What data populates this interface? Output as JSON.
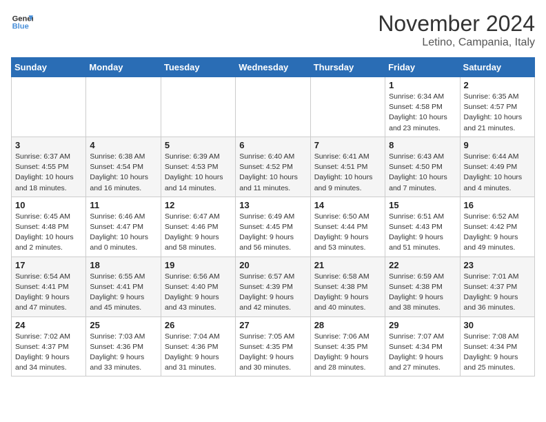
{
  "header": {
    "logo_line1": "General",
    "logo_line2": "Blue",
    "month": "November 2024",
    "location": "Letino, Campania, Italy"
  },
  "days_of_week": [
    "Sunday",
    "Monday",
    "Tuesday",
    "Wednesday",
    "Thursday",
    "Friday",
    "Saturday"
  ],
  "weeks": [
    [
      {
        "day": "",
        "info": ""
      },
      {
        "day": "",
        "info": ""
      },
      {
        "day": "",
        "info": ""
      },
      {
        "day": "",
        "info": ""
      },
      {
        "day": "",
        "info": ""
      },
      {
        "day": "1",
        "info": "Sunrise: 6:34 AM\nSunset: 4:58 PM\nDaylight: 10 hours and 23 minutes."
      },
      {
        "day": "2",
        "info": "Sunrise: 6:35 AM\nSunset: 4:57 PM\nDaylight: 10 hours and 21 minutes."
      }
    ],
    [
      {
        "day": "3",
        "info": "Sunrise: 6:37 AM\nSunset: 4:55 PM\nDaylight: 10 hours and 18 minutes."
      },
      {
        "day": "4",
        "info": "Sunrise: 6:38 AM\nSunset: 4:54 PM\nDaylight: 10 hours and 16 minutes."
      },
      {
        "day": "5",
        "info": "Sunrise: 6:39 AM\nSunset: 4:53 PM\nDaylight: 10 hours and 14 minutes."
      },
      {
        "day": "6",
        "info": "Sunrise: 6:40 AM\nSunset: 4:52 PM\nDaylight: 10 hours and 11 minutes."
      },
      {
        "day": "7",
        "info": "Sunrise: 6:41 AM\nSunset: 4:51 PM\nDaylight: 10 hours and 9 minutes."
      },
      {
        "day": "8",
        "info": "Sunrise: 6:43 AM\nSunset: 4:50 PM\nDaylight: 10 hours and 7 minutes."
      },
      {
        "day": "9",
        "info": "Sunrise: 6:44 AM\nSunset: 4:49 PM\nDaylight: 10 hours and 4 minutes."
      }
    ],
    [
      {
        "day": "10",
        "info": "Sunrise: 6:45 AM\nSunset: 4:48 PM\nDaylight: 10 hours and 2 minutes."
      },
      {
        "day": "11",
        "info": "Sunrise: 6:46 AM\nSunset: 4:47 PM\nDaylight: 10 hours and 0 minutes."
      },
      {
        "day": "12",
        "info": "Sunrise: 6:47 AM\nSunset: 4:46 PM\nDaylight: 9 hours and 58 minutes."
      },
      {
        "day": "13",
        "info": "Sunrise: 6:49 AM\nSunset: 4:45 PM\nDaylight: 9 hours and 56 minutes."
      },
      {
        "day": "14",
        "info": "Sunrise: 6:50 AM\nSunset: 4:44 PM\nDaylight: 9 hours and 53 minutes."
      },
      {
        "day": "15",
        "info": "Sunrise: 6:51 AM\nSunset: 4:43 PM\nDaylight: 9 hours and 51 minutes."
      },
      {
        "day": "16",
        "info": "Sunrise: 6:52 AM\nSunset: 4:42 PM\nDaylight: 9 hours and 49 minutes."
      }
    ],
    [
      {
        "day": "17",
        "info": "Sunrise: 6:54 AM\nSunset: 4:41 PM\nDaylight: 9 hours and 47 minutes."
      },
      {
        "day": "18",
        "info": "Sunrise: 6:55 AM\nSunset: 4:41 PM\nDaylight: 9 hours and 45 minutes."
      },
      {
        "day": "19",
        "info": "Sunrise: 6:56 AM\nSunset: 4:40 PM\nDaylight: 9 hours and 43 minutes."
      },
      {
        "day": "20",
        "info": "Sunrise: 6:57 AM\nSunset: 4:39 PM\nDaylight: 9 hours and 42 minutes."
      },
      {
        "day": "21",
        "info": "Sunrise: 6:58 AM\nSunset: 4:38 PM\nDaylight: 9 hours and 40 minutes."
      },
      {
        "day": "22",
        "info": "Sunrise: 6:59 AM\nSunset: 4:38 PM\nDaylight: 9 hours and 38 minutes."
      },
      {
        "day": "23",
        "info": "Sunrise: 7:01 AM\nSunset: 4:37 PM\nDaylight: 9 hours and 36 minutes."
      }
    ],
    [
      {
        "day": "24",
        "info": "Sunrise: 7:02 AM\nSunset: 4:37 PM\nDaylight: 9 hours and 34 minutes."
      },
      {
        "day": "25",
        "info": "Sunrise: 7:03 AM\nSunset: 4:36 PM\nDaylight: 9 hours and 33 minutes."
      },
      {
        "day": "26",
        "info": "Sunrise: 7:04 AM\nSunset: 4:36 PM\nDaylight: 9 hours and 31 minutes."
      },
      {
        "day": "27",
        "info": "Sunrise: 7:05 AM\nSunset: 4:35 PM\nDaylight: 9 hours and 30 minutes."
      },
      {
        "day": "28",
        "info": "Sunrise: 7:06 AM\nSunset: 4:35 PM\nDaylight: 9 hours and 28 minutes."
      },
      {
        "day": "29",
        "info": "Sunrise: 7:07 AM\nSunset: 4:34 PM\nDaylight: 9 hours and 27 minutes."
      },
      {
        "day": "30",
        "info": "Sunrise: 7:08 AM\nSunset: 4:34 PM\nDaylight: 9 hours and 25 minutes."
      }
    ]
  ]
}
